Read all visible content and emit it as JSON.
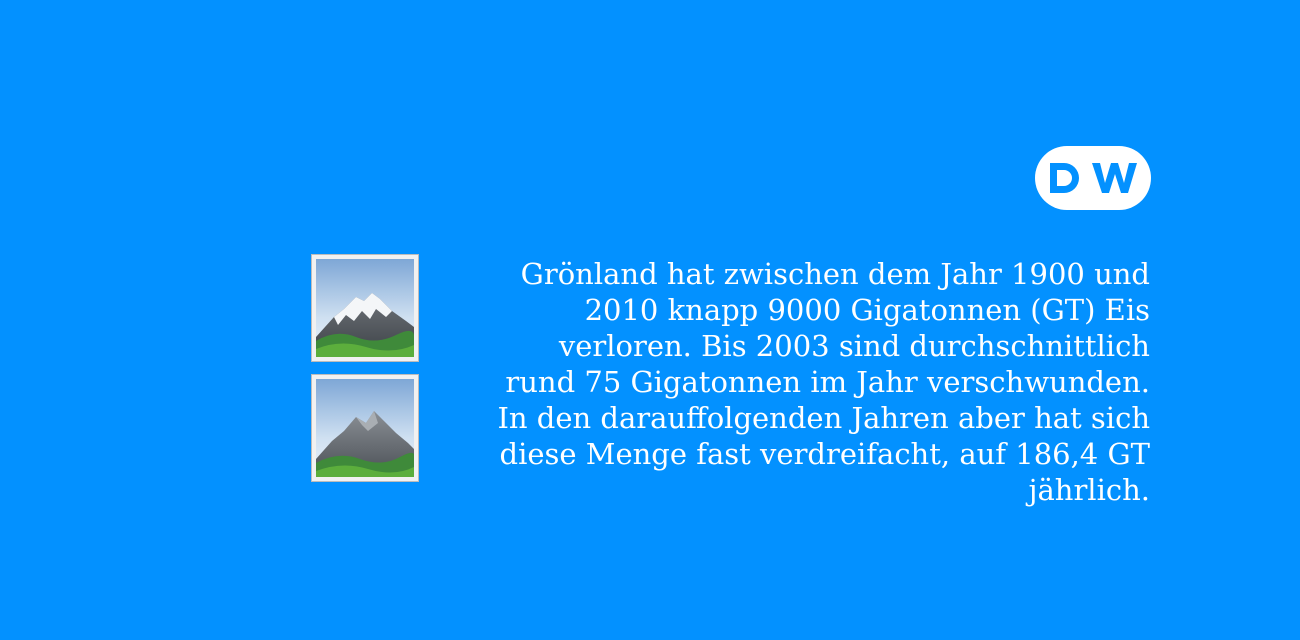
{
  "colors": {
    "background": "#0391ff",
    "text": "#ffffff",
    "logo_circle": "#ffffff",
    "logo_letters": "#0391ff"
  },
  "logo": {
    "icon": "dw-logo-icon",
    "text": "DW"
  },
  "images": [
    {
      "icon": "mountain-snowcap-icon"
    },
    {
      "icon": "mountain-icon"
    }
  ],
  "paragraph": {
    "lines": [
      "Grönland hat zwischen dem Jahr 1900 und",
      "2010 knapp 9000 Gigatonnen (GT) Eis",
      "verloren. Bis 2003 sind durchschnittlich",
      "rund 75 Gigatonnen im Jahr verschwunden.",
      "In den darauffolgenden Jahren aber hat sich",
      "diese Menge fast verdreifacht, auf 186,4 GT",
      "jährlich."
    ]
  }
}
